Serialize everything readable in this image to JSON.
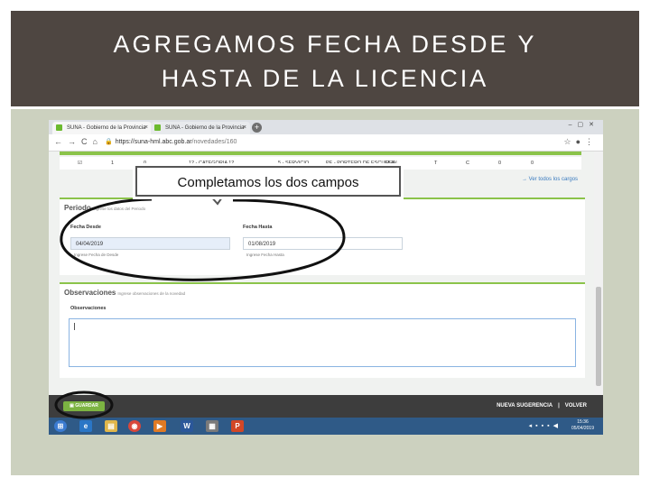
{
  "slide": {
    "title_line1": "AGREGAMOS FECHA DESDE Y",
    "title_line2": "HASTA DE LA LICENCIA",
    "callout_text": "Completamos los dos campos"
  },
  "browser": {
    "tabs": [
      {
        "label": "SUNA - Gobierno de la Provincia",
        "close": "×"
      },
      {
        "label": "SUNA - Gobierno de la Provincia",
        "close": "×"
      }
    ],
    "new_tab": "+",
    "url_host": "https://suna-hml.abc.gob.ar",
    "url_path": "/novedades/160"
  },
  "table_row": {
    "cells": [
      "1",
      "0",
      "12 - CATEGORIA 12",
      "5 - SERVICIO",
      "PE - PORTERO DE ESCUELA",
      "REAL",
      "T",
      "C",
      "0",
      "0"
    ]
  },
  "ver_todos": "→ Ver todos los cargos",
  "periodo": {
    "title": "Periodo",
    "subtitle": "Ingrese los datos del Periodo",
    "fecha_desde": {
      "label": "Fecha Desde",
      "value": "04/04/2019",
      "help": "Ingrese Fecha de Desde"
    },
    "fecha_hasta": {
      "label": "Fecha Hasta",
      "value": "01/08/2019",
      "help": "Ingrese Fecha Hasta"
    }
  },
  "observaciones": {
    "title": "Observaciones",
    "subtitle": "Ingrese observaciones de la novedad",
    "label": "Observaciones"
  },
  "footer": {
    "guardar": "GUARDAR",
    "nueva_sugerencia": "NUEVA SUGERENCIA",
    "separator": "|",
    "volver": "VOLVER"
  },
  "taskbar": {
    "time": "15:36",
    "date": "05/04/2019"
  },
  "colors": {
    "title_bar": "#4e4641",
    "panel": "#ccd1bf",
    "accent_green": "#8bc34a",
    "annotation": "#111111"
  }
}
